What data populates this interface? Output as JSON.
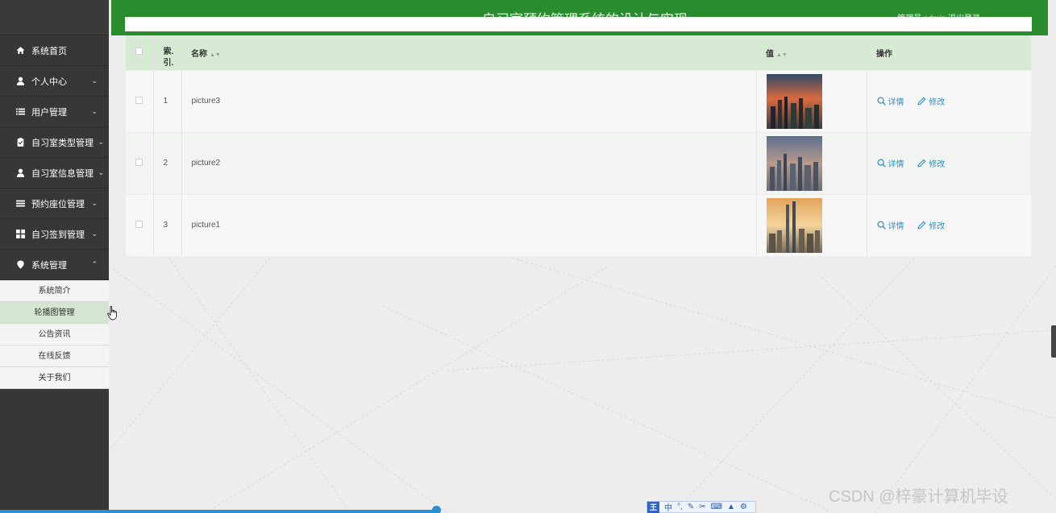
{
  "header": {
    "title": "自习室预约管理系统的设计与实现",
    "user_info": "管理员 admin  退出登录"
  },
  "sidebar": {
    "items": [
      {
        "label": "系统首页",
        "icon": "home-icon"
      },
      {
        "label": "个人中心",
        "icon": "user-icon"
      },
      {
        "label": "用户管理",
        "icon": "list-icon"
      },
      {
        "label": "自习室类型管理",
        "icon": "clipboard-icon"
      },
      {
        "label": "自习室信息管理",
        "icon": "user-icon"
      },
      {
        "label": "预约座位管理",
        "icon": "bars-icon"
      },
      {
        "label": "自习签到管理",
        "icon": "grid-icon"
      },
      {
        "label": "系统管理",
        "icon": "location-icon"
      }
    ],
    "submenu": [
      "系统简介",
      "轮播图管理",
      "公告资讯",
      "在线反馈",
      "关于我们"
    ],
    "active_sub": "轮播图管理"
  },
  "table": {
    "headers": {
      "index": "索.\n引.",
      "name": "名称",
      "value": "值",
      "action": "操作"
    },
    "rows": [
      {
        "index": "1",
        "name": "picture3"
      },
      {
        "index": "2",
        "name": "picture2"
      },
      {
        "index": "3",
        "name": "picture1"
      }
    ],
    "detail_label": "详情",
    "edit_label": "修改"
  },
  "ime": {
    "logo": "王",
    "mode": "中"
  },
  "watermark": "CSDN @梓豪计算机毕设",
  "colors": {
    "header": "#2a8d2d",
    "sidebar": "#373737",
    "table_header": "#d7ebd4",
    "link": "#2b90c9"
  }
}
